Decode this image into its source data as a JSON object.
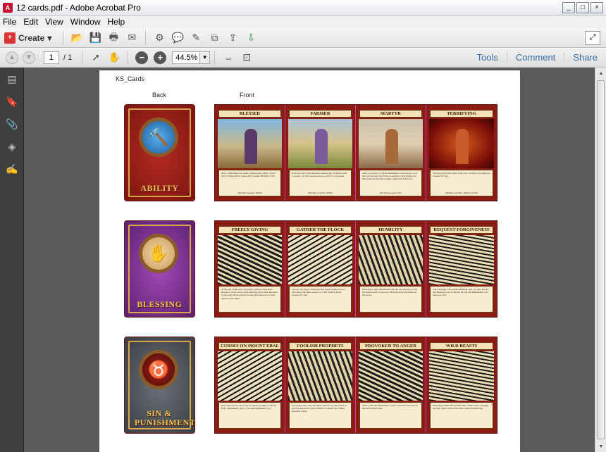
{
  "window": {
    "title": "12 cards.pdf - Adobe Acrobat Pro",
    "app_icon": "pdf-icon",
    "controls": [
      "_",
      "□",
      "×"
    ]
  },
  "menu": [
    "File",
    "Edit",
    "View",
    "Window",
    "Help"
  ],
  "toolbar": {
    "create_label": "Create",
    "create_arrow": "▾",
    "icons": [
      "open-folder-icon",
      "save-icon",
      "print-icon",
      "email-icon",
      "settings-icon",
      "comment-icon",
      "sign-icon",
      "combine-icon",
      "export-icon",
      "share-icon"
    ]
  },
  "nav": {
    "page_current": "1",
    "page_total": "/ 1",
    "zoom": "44.5%",
    "zoom_out": "−",
    "zoom_in": "+",
    "tools_label": "Tools",
    "comment_label": "Comment",
    "share_label": "Share"
  },
  "sidebar_icons": [
    "pages-icon",
    "bookmark-icon",
    "attachment-icon",
    "layers-icon",
    "signature-icon"
  ],
  "document": {
    "header": "KS_Cards",
    "back_label": "Back",
    "front_label": "Front",
    "rows": [
      {
        "back_title": "ABILITY",
        "back_color": "red",
        "emblem": "hammer-hand-icon",
        "cards": [
          {
            "title": "BLESSED",
            "text": "Draw a Blessing Card when acquiring this ability. At the start of King Ahab's round, draw another Blessing Card.",
            "start": "Starting Location: Bethel"
          },
          {
            "title": "FARMER",
            "text": "If the top card of the Resource discard pile is either Cattle or Goats, you may use an action to add it to your hand.",
            "start": "Starting Location: Tishbe"
          },
          {
            "title": "MARTYR",
            "text": "After a Location or Sin & Punishment card is drawn, you may prevent that card from occurring by discarding your hand and placing your prophet token back in the box.",
            "start": "Starting Location: Dor"
          },
          {
            "title": "TERRIFYING",
            "text": "You may move the Cubes from your location to an adjacent location for free.",
            "start": "Starting Location: Mount Carmel"
          }
        ]
      },
      {
        "back_title": "BLESSING",
        "back_color": "purple",
        "emblem": "open-hand-icon",
        "cards": [
          {
            "title": "FREELY GIVING",
            "text": "At the end of this turn, any player with less than three Resource Cards draws cards until they have three Resource Cards. Any player with more than three Resource Cards discards their hand.",
            "start": ""
          },
          {
            "title": "GATHER THE FLOCK",
            "text": "Choose one player. Wherever that player stands, move a Sin Cube from their location to a Sin Cube from the location for free.",
            "start": ""
          },
          {
            "title": "HUMILITY",
            "text": "Each player may immediately discard one Resource Card from their hand to remove a Sin Cube from anywhere on the board.",
            "start": ""
          },
          {
            "title": "REQUEST FORGIVENESS",
            "text": "After drawing a Sin and Punishment card you may discard this Blessing Card to discard the Sin and Punishment card drawn as well.",
            "start": ""
          }
        ]
      },
      {
        "back_title": "SIN & PUNISHMENT",
        "back_color": "grey",
        "emblem": "idol-icon",
        "cards": [
          {
            "title": "CURSES ON MOUNT EBAL",
            "text": "Place this card on top of any Location's prophet or Mount Ebal. Immediately draw a Sin and Punishment card.",
            "start": ""
          },
          {
            "title": "FOOLISH PROPHETS",
            "text": "Any player who does not either remove two Sin Cubes or use their Resource Card will have to discard all of their Resource Cards.",
            "start": ""
          },
          {
            "title": "PROVOKED TO ANGER",
            "text": "Draw a Sin and Punishment card for each idol on board at the end of this round.",
            "start": ""
          },
          {
            "title": "WILD BEASTS",
            "text": "Each player must discard half their Cattle Cards, rounding up. Any Cattle Cards drawn this round are discarded.",
            "start": ""
          }
        ]
      }
    ]
  }
}
